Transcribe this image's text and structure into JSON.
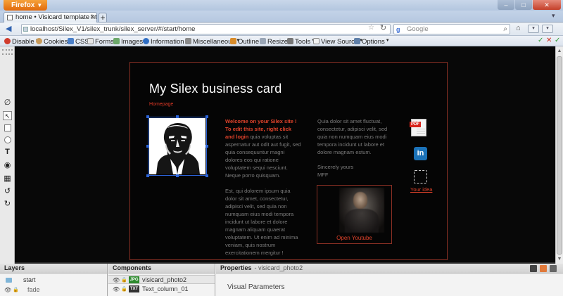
{
  "browser": {
    "menu_button": "Firefox",
    "tab_title": "home • Visicard template html t...",
    "url": "localhost/Silex_V1/silex_trunk/silex_server/#/start/home",
    "search_placeholder": "Google"
  },
  "webdev_toolbar": {
    "items": [
      "Disable",
      "Cookies",
      "CSS",
      "Forms",
      "Images",
      "Information",
      "Miscellaneous",
      "Outline",
      "Resize",
      "Tools",
      "View Source",
      "Options"
    ]
  },
  "card": {
    "title": "My Silex business card",
    "home_link": "Homepage",
    "column1": {
      "highlight": "Welcome on your Silex site ! To edit this site, right click and login",
      "paragraph1_rest": " quia voluptas sit aspernatur aut odit aut fugit, sed quia consequuntur magni dolores eos qui ratione voluptatem sequi nesciunt. Neque porro quisquam.",
      "paragraph2": "Est, qui dolorem ipsum quia dolor sit amet, consectetur, adipisci velit, sed quia non numquam eius modi tempora incidunt ut labore et dolore magnam aliquam quaerat voluptatem. Ut enim ad minima veniam, quis nostrum exercitationem mergitur !"
    },
    "column2": {
      "paragraph1": "Quia dolor sit amet fluctuat, consectetur, adipisci velit, sed quia non numquam eius modi tempora incidunt ut labore et dolore magnam estum.",
      "signoff": "Sincerely yours",
      "initials": "MFF"
    },
    "youtube_link": "Open Youtube",
    "pdf_badge": "PDF",
    "linkedin_letters": "in",
    "idea_link": "Your idea"
  },
  "panels": {
    "layers": {
      "title": "Layers",
      "items": [
        "start",
        "fade"
      ]
    },
    "components": {
      "title": "Components",
      "items": [
        {
          "badge": "JPG",
          "name": "visicard_photo2"
        },
        {
          "badge": "TXT",
          "name": "Text_column_01"
        }
      ]
    },
    "properties": {
      "title": "Properties",
      "subtitle": "- visicard_photo2",
      "section": "Visual Parameters"
    }
  },
  "colors": {
    "accent_red": "#e2432b",
    "card_border": "#8a3024",
    "selection_blue": "#2c64d8"
  }
}
